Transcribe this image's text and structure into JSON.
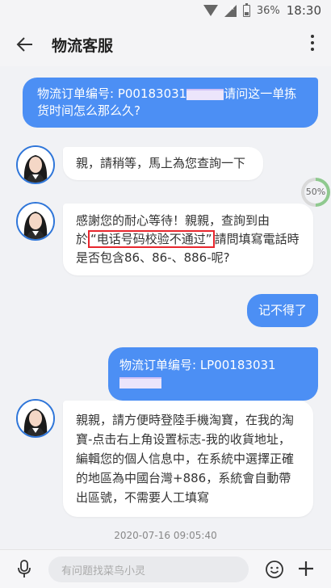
{
  "status": {
    "battery": "36%",
    "time": "18:30"
  },
  "header": {
    "title": "物流客服"
  },
  "messages": {
    "m1": {
      "text": "物流订单编号: P00183031",
      "text2": "请问这一单拣货时间怎么那么久?"
    },
    "m2": {
      "text": "親，請稍等，馬上為您查詢一下"
    },
    "m3": {
      "text1": "感謝您的耐心等待！親親，查詢到由於",
      "highlight": "“电话号码校验不通过”",
      "text2": "請問填寫電話時是否包含86、86-、886-呢?"
    },
    "m4": {
      "text": "记不得了"
    },
    "m5": {
      "text": "物流订单编号: LP00183031"
    },
    "m6": {
      "text": "親親，請方便時登陸手機淘寶，在我的淘寶-点击右上角设置标志-我的收貨地址，編輯您的個人信息中，在系統中選擇正確的地區為中國台灣+886，系統會自動帶出區號，不需要人工填寫"
    }
  },
  "progress": {
    "label": "50%",
    "value": 0.5
  },
  "timestamp": "2020-07-16 09:05:40",
  "input": {
    "placeholder": "有问题找菜鸟小灵"
  }
}
